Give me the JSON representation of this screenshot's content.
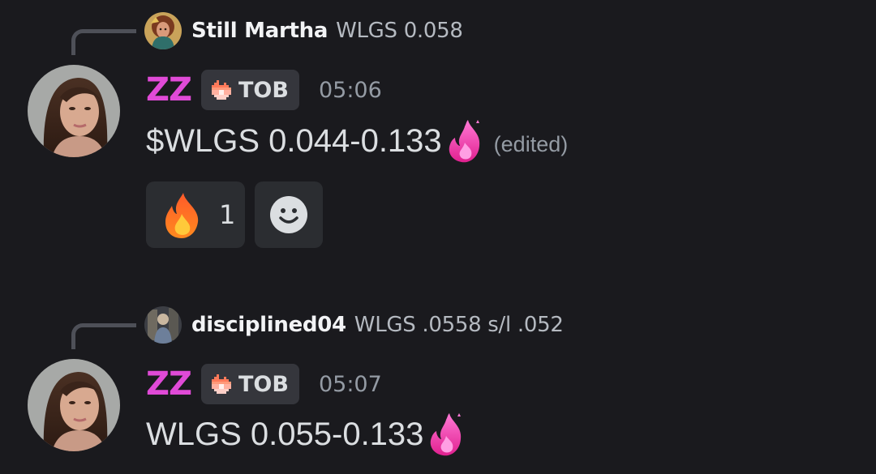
{
  "messages": [
    {
      "reply": {
        "author": "Still Martha",
        "text": "WLGS 0.058",
        "avatar_icon": "illustrated-woman-avatar"
      },
      "author": {
        "name": "ZZ",
        "color": "#e04ad7",
        "avatar_icon": "woman-portrait-avatar"
      },
      "tag": {
        "icon": "pixel-flame-icon",
        "label": "TOB"
      },
      "timestamp": "05:06",
      "content": "$WLGS 0.044-0.133",
      "content_emoji": "pink-flame-emoji",
      "edited_label": "(edited)",
      "reactions": [
        {
          "emoji": "fire-emoji",
          "count": "1"
        }
      ],
      "add_reaction_icon": "smiley-face-icon"
    },
    {
      "reply": {
        "author": "disciplined04",
        "text": "WLGS .0558 s/l .052",
        "avatar_icon": "figure-avatar"
      },
      "author": {
        "name": "ZZ",
        "color": "#e04ad7",
        "avatar_icon": "woman-portrait-avatar"
      },
      "tag": {
        "icon": "pixel-flame-icon",
        "label": "TOB"
      },
      "timestamp": "05:07",
      "content": "WLGS 0.055-0.133",
      "content_emoji": "pink-flame-emoji"
    }
  ],
  "colors": {
    "background": "#1a1a1e",
    "text": "#dbdee1",
    "muted": "#949ba4",
    "username": "#e04ad7",
    "tag_bg": "#35363c",
    "reaction_bg": "#2b2d31"
  }
}
